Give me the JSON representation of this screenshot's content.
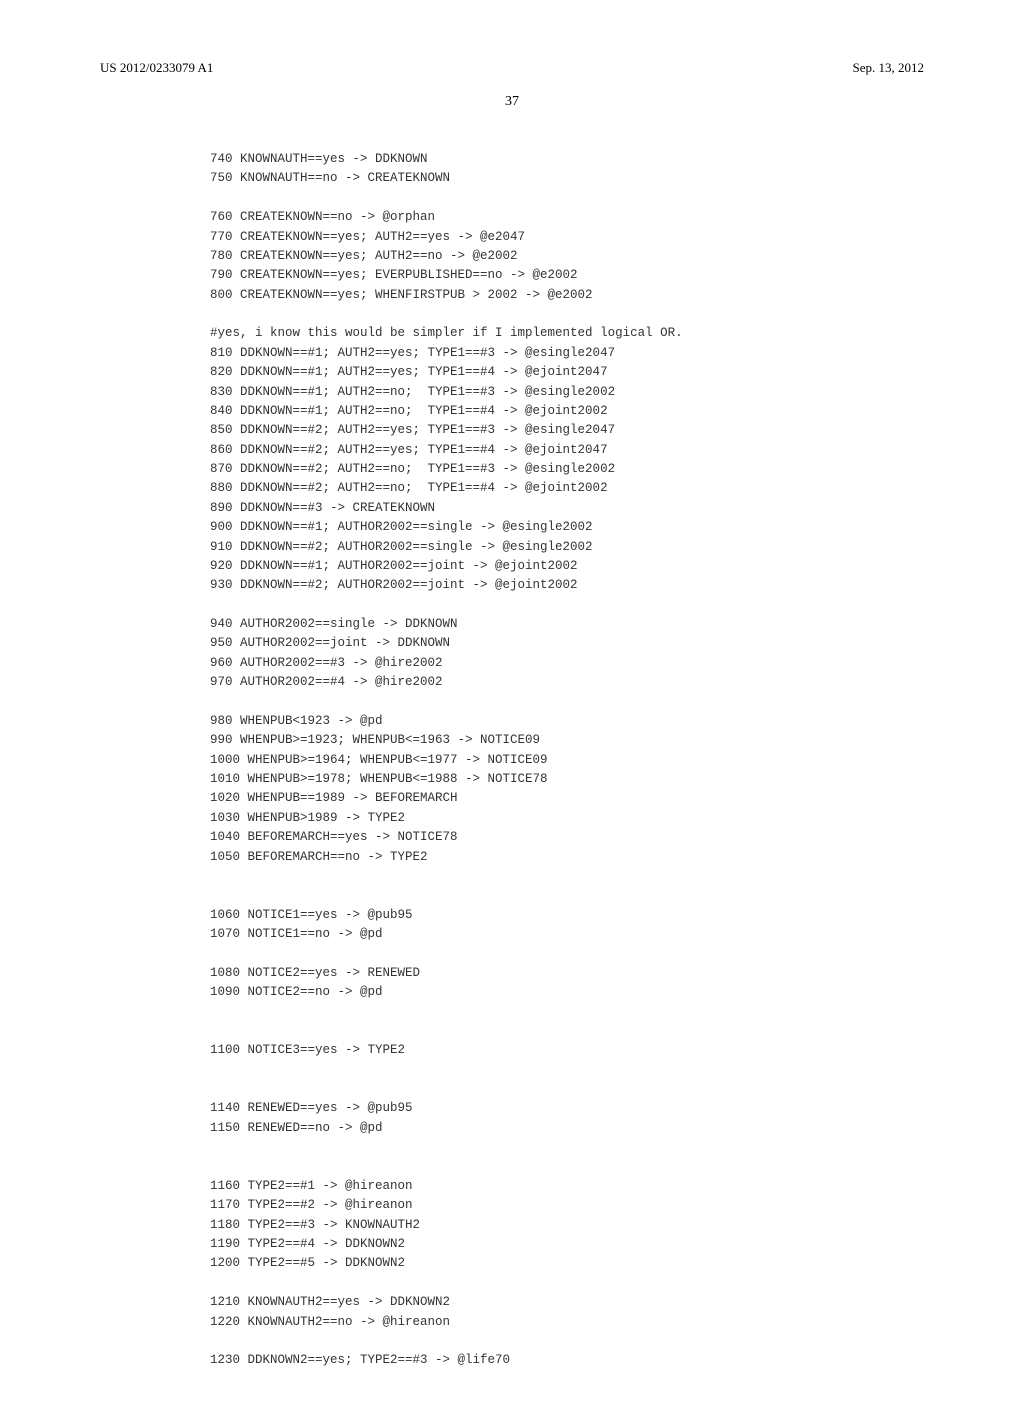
{
  "header": {
    "pub_number": "US 2012/0233079 A1",
    "date": "Sep. 13, 2012"
  },
  "page_number": "37",
  "code_lines": [
    "740 KNOWNAUTH==yes -> DDKNOWN",
    "750 KNOWNAUTH==no -> CREATEKNOWN",
    "",
    "760 CREATEKNOWN==no -> @orphan",
    "770 CREATEKNOWN==yes; AUTH2==yes -> @e2047",
    "780 CREATEKNOWN==yes; AUTH2==no -> @e2002",
    "790 CREATEKNOWN==yes; EVERPUBLISHED==no -> @e2002",
    "800 CREATEKNOWN==yes; WHENFIRSTPUB > 2002 -> @e2002",
    "",
    "#yes, i know this would be simpler if I implemented logical OR.",
    "810 DDKNOWN==#1; AUTH2==yes; TYPE1==#3 -> @esingle2047",
    "820 DDKNOWN==#1; AUTH2==yes; TYPE1==#4 -> @ejoint2047",
    "830 DDKNOWN==#1; AUTH2==no;  TYPE1==#3 -> @esingle2002",
    "840 DDKNOWN==#1; AUTH2==no;  TYPE1==#4 -> @ejoint2002",
    "850 DDKNOWN==#2; AUTH2==yes; TYPE1==#3 -> @esingle2047",
    "860 DDKNOWN==#2; AUTH2==yes; TYPE1==#4 -> @ejoint2047",
    "870 DDKNOWN==#2; AUTH2==no;  TYPE1==#3 -> @esingle2002",
    "880 DDKNOWN==#2; AUTH2==no;  TYPE1==#4 -> @ejoint2002",
    "890 DDKNOWN==#3 -> CREATEKNOWN",
    "900 DDKNOWN==#1; AUTHOR2002==single -> @esingle2002",
    "910 DDKNOWN==#2; AUTHOR2002==single -> @esingle2002",
    "920 DDKNOWN==#1; AUTHOR2002==joint -> @ejoint2002",
    "930 DDKNOWN==#2; AUTHOR2002==joint -> @ejoint2002",
    "",
    "940 AUTHOR2002==single -> DDKNOWN",
    "950 AUTHOR2002==joint -> DDKNOWN",
    "960 AUTHOR2002==#3 -> @hire2002",
    "970 AUTHOR2002==#4 -> @hire2002",
    "",
    "980 WHENPUB<1923 -> @pd",
    "990 WHENPUB>=1923; WHENPUB<=1963 -> NOTICE09",
    "1000 WHENPUB>=1964; WHENPUB<=1977 -> NOTICE09",
    "1010 WHENPUB>=1978; WHENPUB<=1988 -> NOTICE78",
    "1020 WHENPUB==1989 -> BEFOREMARCH",
    "1030 WHENPUB>1989 -> TYPE2",
    "1040 BEFOREMARCH==yes -> NOTICE78",
    "1050 BEFOREMARCH==no -> TYPE2",
    "",
    "",
    "1060 NOTICE1==yes -> @pub95",
    "1070 NOTICE1==no -> @pd",
    "",
    "1080 NOTICE2==yes -> RENEWED",
    "1090 NOTICE2==no -> @pd",
    "",
    "",
    "1100 NOTICE3==yes -> TYPE2",
    "",
    "",
    "1140 RENEWED==yes -> @pub95",
    "1150 RENEWED==no -> @pd",
    "",
    "",
    "1160 TYPE2==#1 -> @hireanon",
    "1170 TYPE2==#2 -> @hireanon",
    "1180 TYPE2==#3 -> KNOWNAUTH2",
    "1190 TYPE2==#4 -> DDKNOWN2",
    "1200 TYPE2==#5 -> DDKNOWN2",
    "",
    "1210 KNOWNAUTH2==yes -> DDKNOWN2",
    "1220 KNOWNAUTH2==no -> @hireanon",
    "",
    "1230 DDKNOWN2==yes; TYPE2==#3 -> @life70"
  ]
}
